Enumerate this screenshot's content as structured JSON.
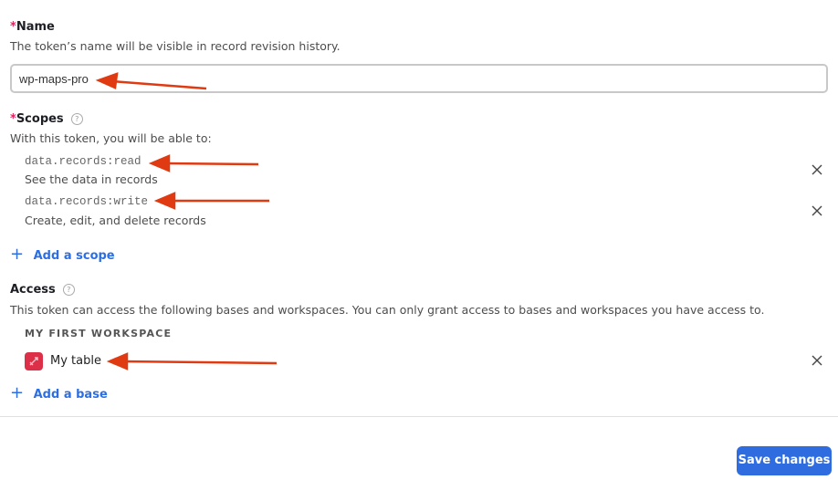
{
  "name_field": {
    "required_marker": "*",
    "label": "Name",
    "description": "The token’s name will be visible in record revision history.",
    "value": "wp-maps-pro"
  },
  "scopes": {
    "required_marker": "*",
    "label": "Scopes",
    "help_icon": "question-circle-icon",
    "description": "With this token, you will be able to:",
    "items": [
      {
        "scope": "data.records:read",
        "description": "See the data in records"
      },
      {
        "scope": "data.records:write",
        "description": "Create, edit, and delete records"
      }
    ],
    "add_label": "Add a scope"
  },
  "access": {
    "label": "Access",
    "help_icon": "question-circle-icon",
    "description": "This token can access the following bases and workspaces. You can only grant access to bases and workspaces you have access to.",
    "workspace": "MY FIRST WORKSPACE",
    "bases": [
      {
        "name": "My table",
        "icon": "rocket-icon",
        "color": "#dc2f48"
      }
    ],
    "add_label": "Add a base"
  },
  "footer": {
    "save_label": "Save changes"
  },
  "annotations": {
    "arrow_color": "#e03a12"
  }
}
